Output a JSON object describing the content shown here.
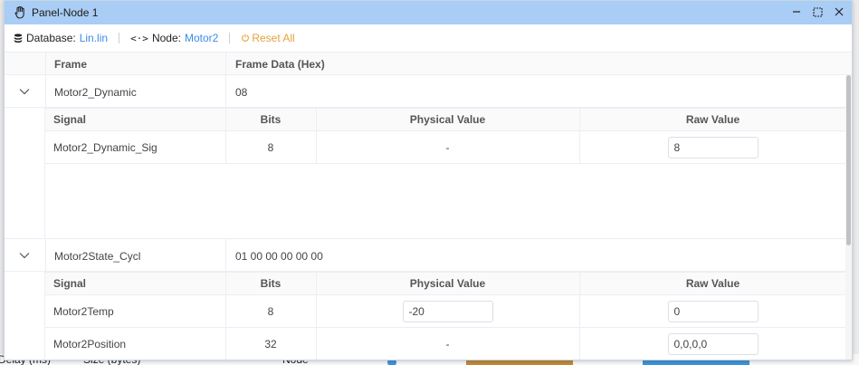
{
  "window": {
    "title": "Panel-Node 1"
  },
  "toolbar": {
    "database_label": "Database:",
    "database_value": "Lin.lin",
    "node_label": "Node:",
    "node_value": "Motor2",
    "reset_label": "Reset All"
  },
  "table": {
    "headers": {
      "frame": "Frame",
      "frame_data": "Frame Data (Hex)"
    },
    "signal_headers": {
      "signal": "Signal",
      "bits": "Bits",
      "physical": "Physical Value",
      "raw": "Raw Value"
    },
    "frames": [
      {
        "name": "Motor2_Dynamic",
        "data": "08",
        "signals": [
          {
            "name": "Motor2_Dynamic_Sig",
            "bits": "8",
            "physical": "-",
            "raw": "8"
          }
        ]
      },
      {
        "name": "Motor2State_Cycl",
        "data": "01 00 00 00 00 00",
        "signals": [
          {
            "name": "Motor2Temp",
            "bits": "8",
            "physical": "-20",
            "raw": "0"
          },
          {
            "name": "Motor2Position",
            "bits": "32",
            "physical": "-",
            "raw": "0,0,0,0"
          }
        ]
      }
    ]
  },
  "background": {
    "col1": "Delay (ms)",
    "col2": "Size (bytes)",
    "col3": "Node"
  },
  "colors": {
    "titlebar": "#a9cdf5",
    "link": "#3a8ee6",
    "reset": "#e6a23c"
  }
}
